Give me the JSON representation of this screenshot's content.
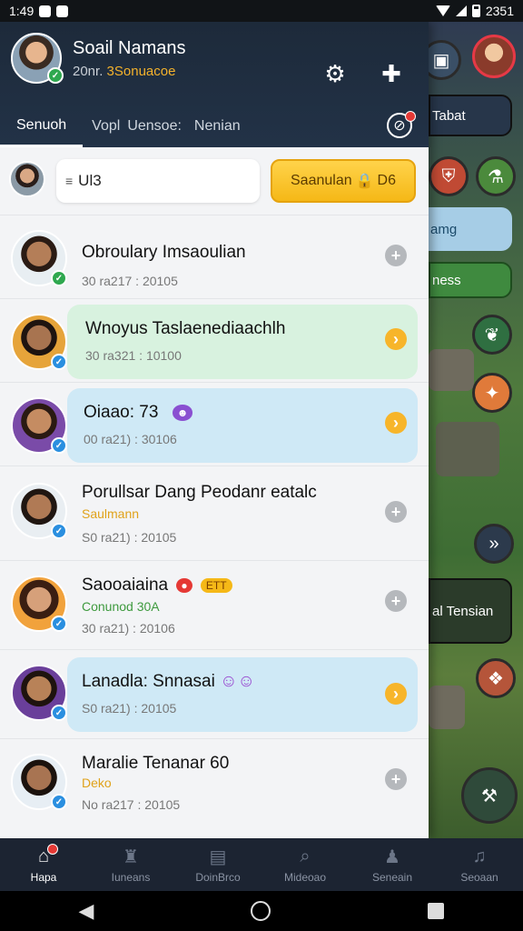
{
  "status_bar": {
    "time": "1:49",
    "right_text": "2351"
  },
  "header": {
    "user_name": "Soail Namans",
    "user_sub_prefix": "20nr.",
    "user_sub_highlight": "3Sonuacoe",
    "tabs": [
      {
        "label": "Senuoh"
      },
      {
        "label": "Vopl"
      },
      {
        "label": "Uensoe:"
      },
      {
        "label": "Nenian"
      }
    ]
  },
  "search": {
    "value": "Ul3",
    "button_label": "Saanulan",
    "button_suffix": "D6"
  },
  "friends": [
    {
      "name": "Obroulary Imsaoulian",
      "tag": "",
      "time": "30 ra217 : 20105",
      "highlight": "",
      "action": "add"
    },
    {
      "name": "Wnoyus Taslaenediaachlh",
      "tag": "",
      "time": "30 ra321 : 10100",
      "highlight": "green",
      "action": "go"
    },
    {
      "name": "Oiaao: 73",
      "tag": "",
      "time": "00 ra21) : 30106",
      "highlight": "blue",
      "action": "go"
    },
    {
      "name": "Porullsar Dang Peodanr eatalc",
      "tag": "Saulmann",
      "time": "S0 ra21) : 20105",
      "highlight": "",
      "action": "add"
    },
    {
      "name": "Saooaiaina",
      "tag": "Conunod 30A",
      "time": "30 ra21) : 20106",
      "highlight": "",
      "action": "add",
      "badge": "ETT"
    },
    {
      "name": "Lanadla: Snnasai",
      "tag": "",
      "time": "S0 ra21) : 20105",
      "highlight": "blue",
      "action": "go"
    },
    {
      "name": "Maralie Tenanar 60",
      "tag": "Deko",
      "time": "No ra217 : 20105",
      "highlight": "",
      "action": "add"
    }
  ],
  "game": {
    "panel_1": "Tabat",
    "panel_2": "amg",
    "panel_3": "ness",
    "panel_4": "al Tensian"
  },
  "bottom_nav": [
    {
      "label": "Hapa",
      "icon": "home-icon"
    },
    {
      "label": "Iuneans",
      "icon": "castle-icon"
    },
    {
      "label": "DoinBrco",
      "icon": "chat-icon"
    },
    {
      "label": "Mideoao",
      "icon": "search-icon"
    },
    {
      "label": "Seneain",
      "icon": "person-icon"
    },
    {
      "label": "Seoaan",
      "icon": "music-icon"
    }
  ],
  "colors": {
    "accent": "#f5b817",
    "header_bg": "#1d2a3a",
    "green_highlight": "#d8f2df",
    "blue_highlight": "#cfe9f6"
  }
}
